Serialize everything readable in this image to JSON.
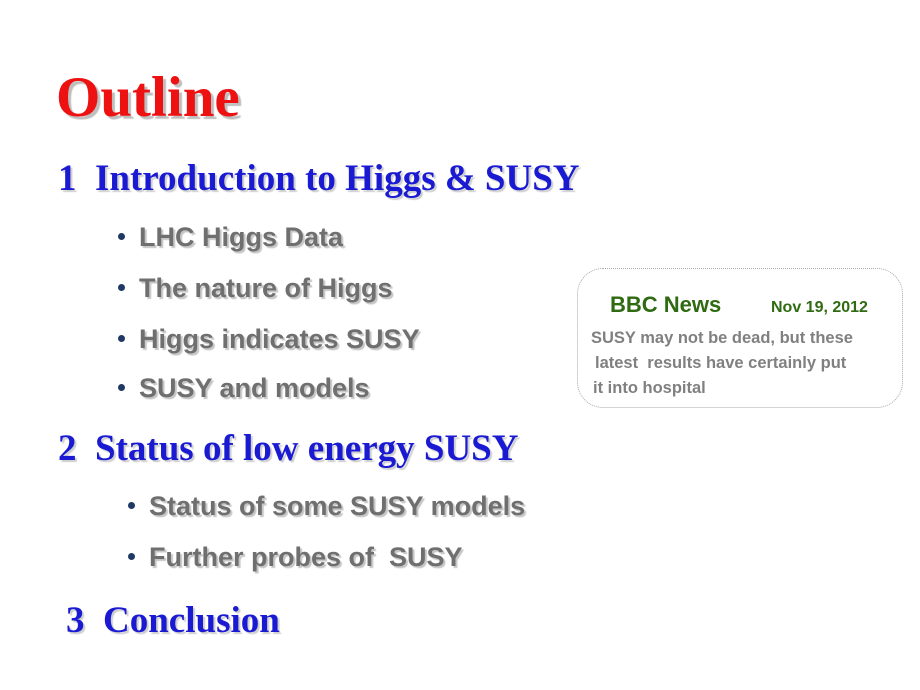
{
  "slide": {
    "title": "Outline",
    "title_color": "#ee1111",
    "heading_color": "#1a1ad2",
    "bullet_text_color": "#6f6f6f",
    "bullet_dot_color": "#1f3864",
    "background": "#ffffff"
  },
  "sections": [
    {
      "number": "1",
      "heading": "1  Introduction to Higgs & SUSY",
      "bullets": [
        "LHC Higgs Data",
        "The nature of Higgs",
        "Higgs indicates SUSY",
        "SUSY and models"
      ]
    },
    {
      "number": "2",
      "heading": "2  Status of low energy SUSY",
      "bullets": [
        "Status of some SUSY models",
        "Further probes of  SUSY"
      ]
    },
    {
      "number": "3",
      "heading": "3  Conclusion",
      "bullets": []
    }
  ],
  "callout": {
    "source": "BBC News",
    "date": "Nov 19, 2012",
    "source_color": "#2f6b12",
    "body_color": "#808080",
    "border_color": "#a9a9a9",
    "body_lines": [
      "SUSY may not be dead, but these",
      "latest  results have certainly put",
      "it into hospital"
    ]
  }
}
